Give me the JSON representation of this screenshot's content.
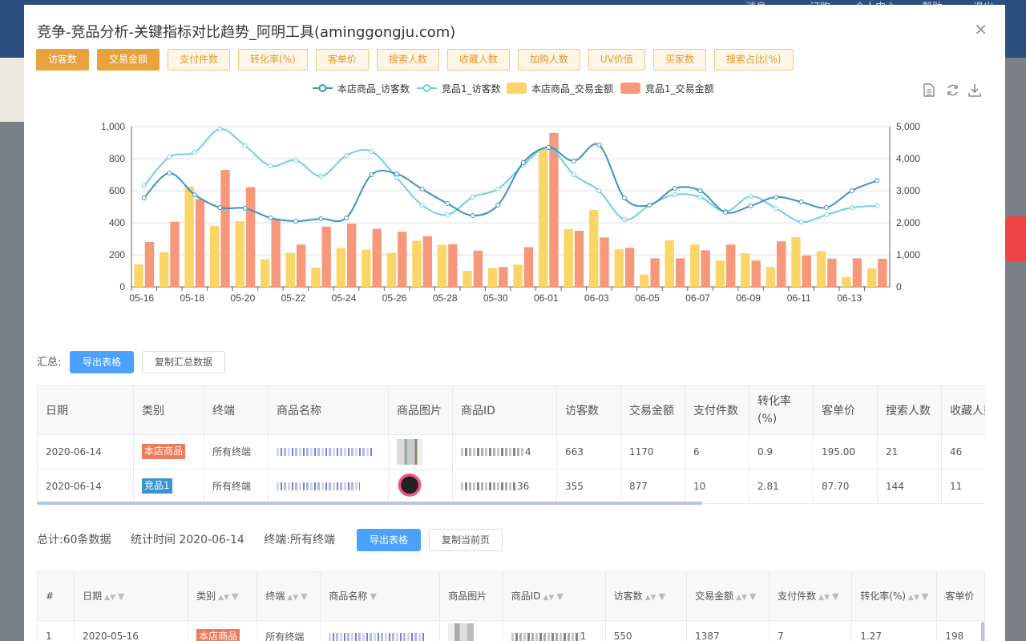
{
  "background": {
    "menu_items": [
      "消息",
      "订购",
      "个人中心",
      "帮助",
      "退出"
    ]
  },
  "modal": {
    "title": "竞争-竞品分析-关键指标对比趋势_阿明工具(aminggongju.com)",
    "close_icon": "close-icon"
  },
  "metric_buttons": [
    {
      "label": "访客数",
      "active": true
    },
    {
      "label": "交易金额",
      "active": true
    },
    {
      "label": "支付件数",
      "active": false
    },
    {
      "label": "转化率(%)",
      "active": false
    },
    {
      "label": "客单价",
      "active": false
    },
    {
      "label": "搜索人数",
      "active": false
    },
    {
      "label": "收藏人数",
      "active": false
    },
    {
      "label": "加购人数",
      "active": false
    },
    {
      "label": "UV价值",
      "active": false
    },
    {
      "label": "买家数",
      "active": false
    },
    {
      "label": "搜索占比(%)",
      "active": false
    }
  ],
  "chart_tools": [
    "document-icon",
    "refresh-icon",
    "download-icon"
  ],
  "colors": {
    "own_visitors": "#3c93c5",
    "comp_visitors": "#6fd0db",
    "own_amount": "#fbd565",
    "comp_amount": "#f7987a",
    "primary": "#4aa1ff",
    "tag_own": "#ef7a58",
    "tag_comp": "#3a95cf"
  },
  "chart_data": {
    "type": "bar+line",
    "title": "",
    "categories": [
      "05-16",
      "05-17",
      "05-18",
      "05-19",
      "05-20",
      "05-21",
      "05-22",
      "05-23",
      "05-24",
      "05-25",
      "05-26",
      "05-27",
      "05-28",
      "05-29",
      "05-30",
      "05-31",
      "06-01",
      "06-02",
      "06-03",
      "06-04",
      "06-05",
      "06-06",
      "06-07",
      "06-08",
      "06-09",
      "06-10",
      "06-11",
      "06-12",
      "06-13",
      "06-14"
    ],
    "x_tick_labels": [
      "05-16",
      "05-18",
      "05-20",
      "05-22",
      "05-24",
      "05-26",
      "05-28",
      "05-30",
      "06-01",
      "06-03",
      "06-05",
      "06-07",
      "06-09",
      "06-11",
      "06-13"
    ],
    "y_left": {
      "min": 0,
      "max": 1000,
      "ticks": [
        "0",
        "200",
        "400",
        "600",
        "800",
        "1,000"
      ]
    },
    "y_right": {
      "min": 0,
      "max": 5000,
      "ticks": [
        "0",
        "1,000",
        "2,000",
        "3,000",
        "4,000",
        "5,000"
      ]
    },
    "legend_position": "top-center",
    "grid": true,
    "series": [
      {
        "name": "本店商品_访客数",
        "type": "line",
        "axis": "left",
        "values": [
          555,
          710,
          575,
          495,
          490,
          430,
          410,
          425,
          430,
          700,
          705,
          610,
          520,
          445,
          510,
          775,
          870,
          785,
          885,
          555,
          510,
          615,
          600,
          465,
          505,
          560,
          530,
          495,
          600,
          663
        ]
      },
      {
        "name": "竞品1_访客数",
        "type": "line",
        "axis": "left",
        "values": [
          630,
          810,
          840,
          985,
          880,
          755,
          790,
          690,
          820,
          845,
          680,
          510,
          450,
          560,
          610,
          760,
          870,
          700,
          600,
          420,
          510,
          575,
          560,
          470,
          565,
          490,
          405,
          450,
          495,
          505
        ]
      },
      {
        "name": "本店商品_交易金额",
        "type": "bar",
        "axis": "right",
        "values": [
          700,
          1080,
          3130,
          1900,
          2050,
          860,
          1060,
          600,
          1210,
          1160,
          1060,
          1440,
          1310,
          500,
          590,
          690,
          4300,
          1800,
          2400,
          1170,
          380,
          1450,
          1320,
          820,
          1050,
          620,
          1550,
          1110,
          310,
          580
        ]
      },
      {
        "name": "竞品1_交易金额",
        "type": "bar",
        "axis": "right",
        "values": [
          1400,
          2030,
          2740,
          3650,
          3110,
          2100,
          1320,
          1880,
          1970,
          1810,
          1720,
          1580,
          1330,
          1130,
          620,
          1240,
          4800,
          1750,
          1540,
          1220,
          890,
          890,
          1140,
          1320,
          820,
          1420,
          980,
          880,
          890,
          877
        ]
      }
    ]
  },
  "summary": {
    "label": "汇总:",
    "export_btn": "导出表格",
    "copy_btn": "复制汇总数据",
    "columns": [
      "日期",
      "类别",
      "终端",
      "商品名称",
      "商品图片",
      "商品ID",
      "访客数",
      "交易金额",
      "支付件数",
      "转化率(%)",
      "客单价",
      "搜索人数",
      "收藏人数"
    ],
    "rows": [
      {
        "date": "2020-06-14",
        "type": "本店商品",
        "terminal": "所有终端",
        "id_tail": "4",
        "visitors": "663",
        "amount": "1170",
        "items": "6",
        "conv": "0.9",
        "price": "195.00",
        "search": "21",
        "fav": "46"
      },
      {
        "date": "2020-06-14",
        "type": "竞品1",
        "terminal": "所有终端",
        "id_tail": "36",
        "visitors": "355",
        "amount": "877",
        "items": "10",
        "conv": "2.81",
        "price": "87.70",
        "search": "144",
        "fav": "11"
      }
    ]
  },
  "detail": {
    "total": "总计:60条数据",
    "stat_time": "统计时间 2020-06-14",
    "terminal": "终端:所有终端",
    "export_btn": "导出表格",
    "copy_btn": "复制当前页",
    "columns": [
      "#",
      "日期",
      "类别",
      "终端",
      "商品名称",
      "商品图片",
      "商品ID",
      "访客数",
      "交易金额",
      "支付件数",
      "转化率(%)",
      "客单价"
    ],
    "rows": [
      {
        "idx": "1",
        "date": "2020-05-16",
        "type": "本店商品",
        "terminal": "所有终端",
        "id_tail": "1",
        "visitors": "550",
        "amount": "1387",
        "items": "7",
        "conv": "1.27",
        "price": "198"
      }
    ]
  }
}
